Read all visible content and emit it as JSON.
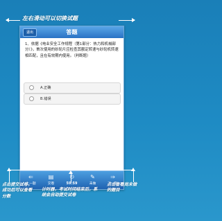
{
  "annotations": {
    "top": "左右滑动可以切换试题",
    "left": "点击提交试卷，成功后可以查看分数",
    "center": "计时器，考试时间结束后，系统会自动提交试卷",
    "right": "点击查看尚未做的题目"
  },
  "app": {
    "back_label": "退出",
    "title": "答题",
    "question": "1、依据《电业安全工作规程（第1部分：热力和机械部分）》，首次使用的砂轮片应检查其额定转速与砂轮机转速相匹配，且在有效期内使用。（判断题）",
    "options": [
      {
        "label": "A.正确",
        "selected": false
      },
      {
        "label": "B.错误",
        "selected": false
      }
    ],
    "toolbar": [
      {
        "label": "上一题",
        "icon": "arrow-left-icon",
        "glyph": "⇐"
      },
      {
        "label": "交卷",
        "icon": "document-icon",
        "glyph": "▤"
      },
      {
        "label": "",
        "icon": "timer",
        "glyph": "59:59"
      },
      {
        "label": "未做",
        "icon": "edit-icon",
        "glyph": "✎"
      },
      {
        "label": "下一题",
        "icon": "arrow-right-icon",
        "glyph": "⇒"
      }
    ]
  }
}
